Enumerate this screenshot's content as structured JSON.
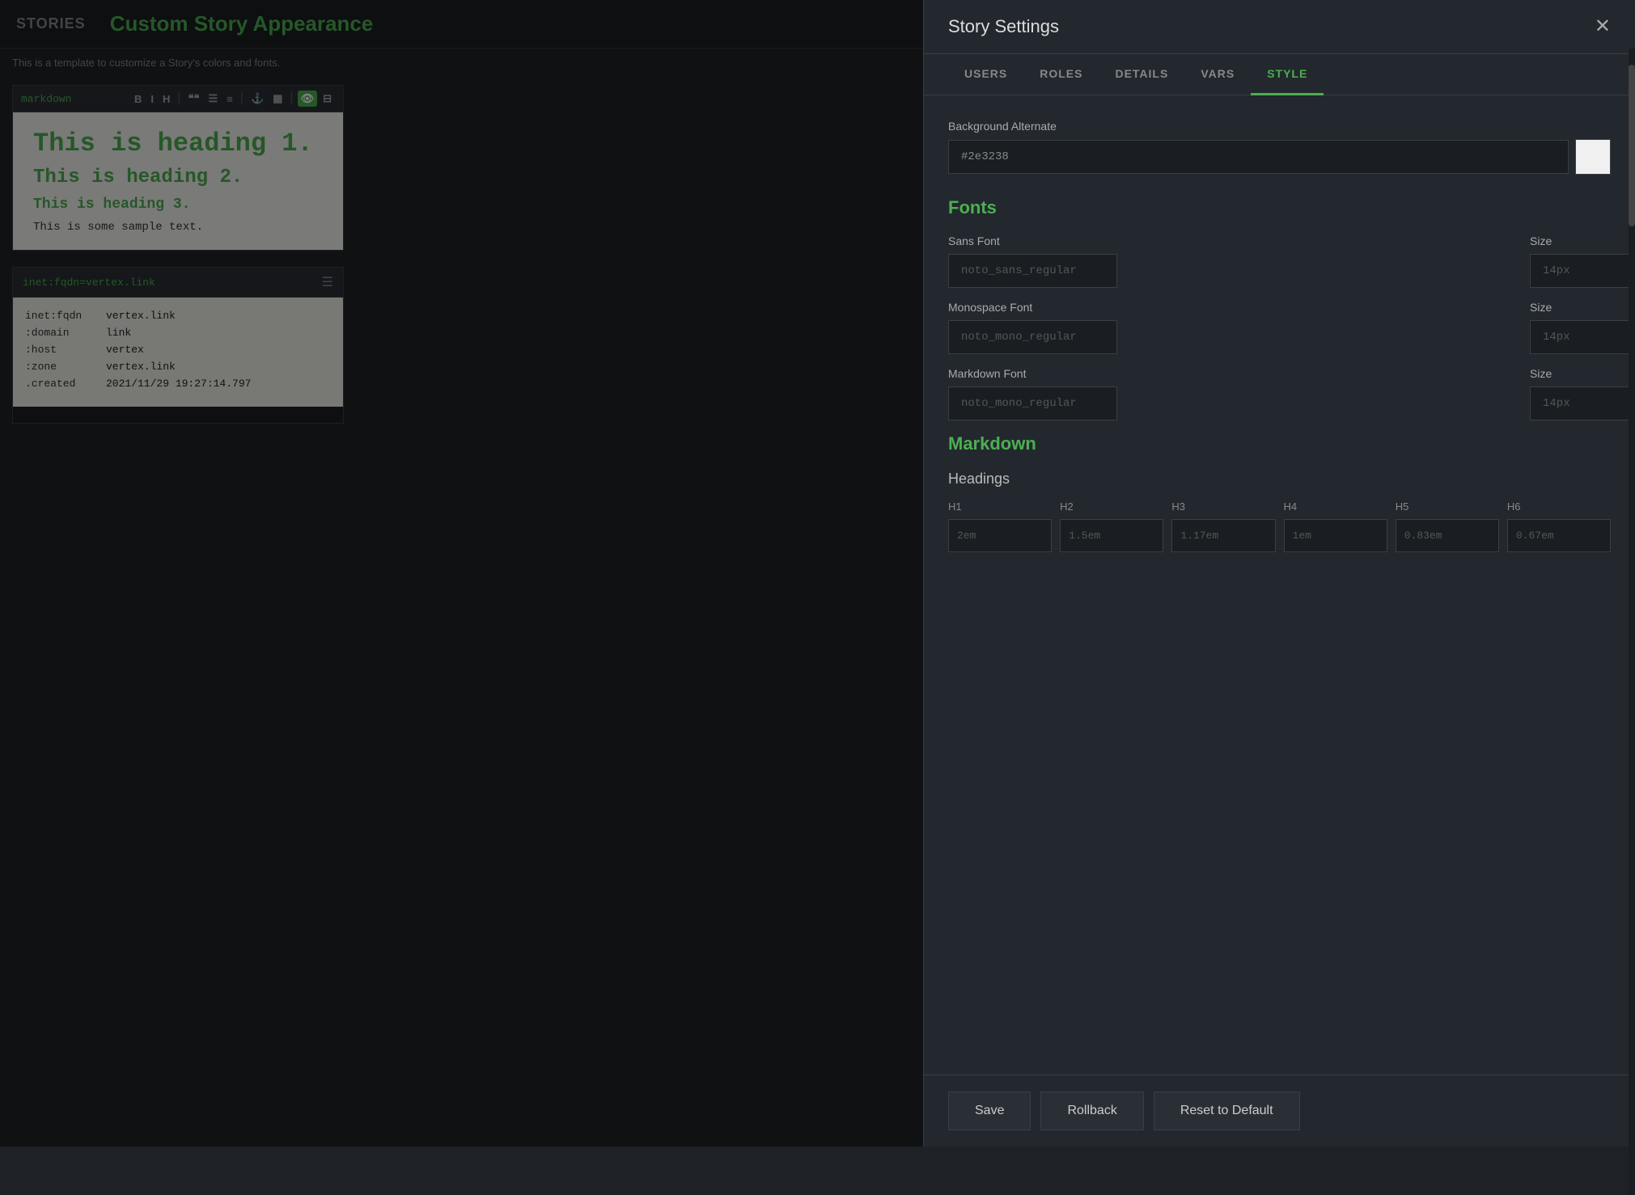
{
  "topbar": {
    "stories_label": "STORIES",
    "page_title": "Custom Story Appearance",
    "subtitle": "This is a template to customize a Story's colors and fonts."
  },
  "editor": {
    "label": "markdown",
    "toolbar": {
      "bold": "B",
      "italic": "I",
      "heading": "H",
      "sep1": "|",
      "quote": "❝",
      "ul": "≡",
      "ol": "≡",
      "sep2": "|",
      "link": "🔗",
      "image": "🖼",
      "sep3": "|",
      "preview": "👁",
      "split": "⊟"
    },
    "preview": {
      "h1": "This is heading 1.",
      "h2": "This is heading 2.",
      "h3": "This is heading 3.",
      "body": "This is some sample text."
    }
  },
  "data_panel": {
    "title": "inet:fqdn=vertex.link",
    "rows": [
      {
        "key": "inet:fqdn",
        "val": "vertex.link"
      },
      {
        "key": ":domain",
        "val": "link"
      },
      {
        "key": ":host",
        "val": "vertex"
      },
      {
        "key": ":zone",
        "val": "vertex.link"
      },
      {
        "key": ".created",
        "val": "2021/11/29 19:27:14.797"
      }
    ]
  },
  "modal": {
    "title": "Story Settings",
    "close_icon": "✕",
    "tabs": [
      {
        "label": "USERS",
        "active": false
      },
      {
        "label": "ROLES",
        "active": false
      },
      {
        "label": "DETAILS",
        "active": false
      },
      {
        "label": "VARS",
        "active": false
      },
      {
        "label": "STYLE",
        "active": true
      }
    ],
    "style_tab": {
      "bg_alternate_label": "Background Alternate",
      "bg_alternate_value": "#2e3238",
      "fonts_heading": "Fonts",
      "sans_font_label": "Sans Font",
      "sans_font_placeholder": "noto_sans_regular",
      "sans_size_label": "Size",
      "sans_size_placeholder": "14px",
      "mono_font_label": "Monospace Font",
      "mono_font_placeholder": "noto_mono_regular",
      "mono_size_label": "Size",
      "mono_size_placeholder": "14px",
      "md_font_label": "Markdown Font",
      "md_font_placeholder": "noto_mono_regular",
      "md_size_label": "Size",
      "md_size_placeholder": "14px",
      "markdown_heading": "Markdown",
      "headings_subheading": "Headings",
      "h_labels": [
        "H1",
        "H2",
        "H3",
        "H4",
        "H5",
        "H6"
      ],
      "h_values": [
        "2em",
        "1.5em",
        "1.17em",
        "1em",
        "0.83em",
        "0.67em"
      ]
    },
    "footer": {
      "save_label": "Save",
      "rollback_label": "Rollback",
      "reset_label": "Reset to Default"
    }
  }
}
